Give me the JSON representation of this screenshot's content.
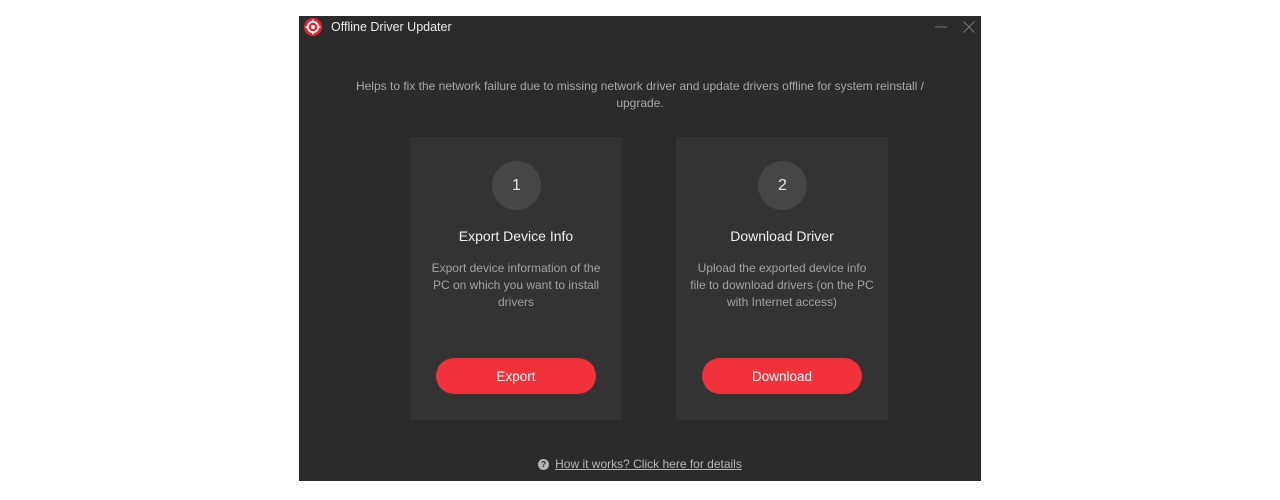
{
  "window": {
    "title": "Offline Driver Updater",
    "logo_icon": "red-gear-logo-icon",
    "controls": [
      "minimize-icon",
      "close-icon"
    ]
  },
  "main": {
    "description": "Helps to fix the network failure due to missing network driver and update drivers offline for system reinstall / upgrade.",
    "steps": [
      {
        "number": "1",
        "title": "Export Device Info",
        "description": "Export device information of the PC on which you want to install drivers",
        "button_label": "Export"
      },
      {
        "number": "2",
        "title": "Download Driver",
        "description": "Upload the exported device info file to download drivers (on the PC with Internet access)",
        "button_label": "Download"
      }
    ]
  },
  "footer": {
    "help_icon": "question-circle-icon",
    "help_glyph": "?",
    "help_link": "How it works? Click here for details"
  },
  "colors": {
    "window_bg": "#2b2b2b",
    "card_bg": "#333333",
    "accent": "#f1323a",
    "step_circle": "#464646"
  }
}
